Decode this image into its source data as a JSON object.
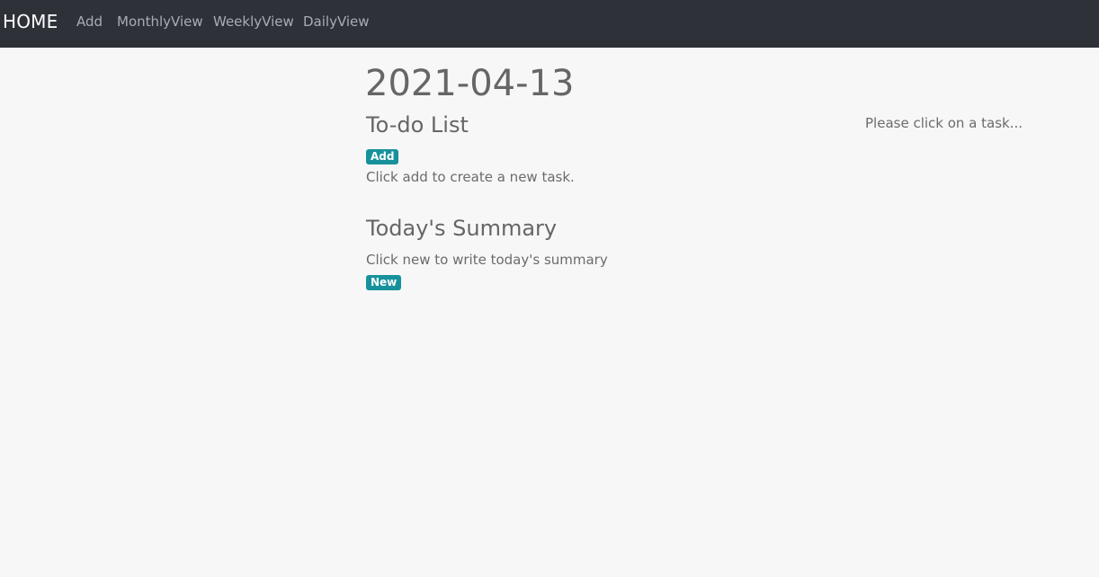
{
  "navbar": {
    "brand": "HOME",
    "links": [
      "Add",
      "MonthlyView",
      "WeeklyView",
      "DailyView"
    ]
  },
  "main": {
    "date": "2021-04-13",
    "todo": {
      "title": "To-do List",
      "add_label": "Add",
      "hint": "Click add to create a new task."
    },
    "summary": {
      "title": "Today's Summary",
      "hint": "Click new to write today's summary",
      "new_label": "New"
    }
  },
  "detail_panel": {
    "placeholder": "Please click on a task..."
  },
  "colors": {
    "navbar_bg": "#2e3138",
    "badge_bg": "#17929c",
    "page_bg": "#f7f7f7"
  }
}
